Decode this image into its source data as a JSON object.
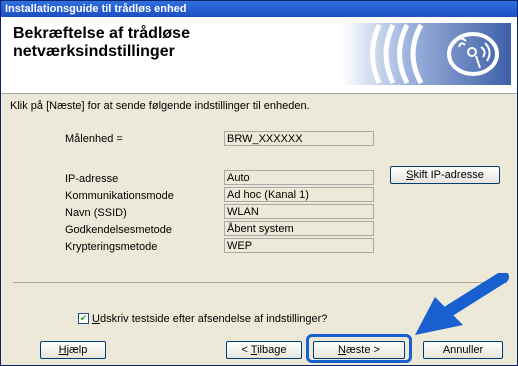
{
  "window": {
    "title": "Installationsguide til trådløs enhed"
  },
  "header": {
    "title_line1": "Bekræftelse af trådløse",
    "title_line2": "netværksindstillinger"
  },
  "instruction": "Klik på [Næste] for at sende følgende indstillinger til enheden.",
  "device": {
    "label": "Målenhed =",
    "value": "BRW_XXXXXX"
  },
  "settings": [
    {
      "label": "IP-adresse",
      "value": "Auto"
    },
    {
      "label": "Kommunikationsmode",
      "value": "Ad hoc (Kanal 1)"
    },
    {
      "label": "Navn (SSID)",
      "value": "WLAN"
    },
    {
      "label": "Godkendelsesmetode",
      "value": "Åbent system"
    },
    {
      "label": "Krypteringsmetode",
      "value": "WEP"
    }
  ],
  "buttons": {
    "change_ip": {
      "mnemonic": "S",
      "rest": "kift IP-adresse"
    },
    "help": {
      "mnemonic": "H",
      "rest": "jælp"
    },
    "back": {
      "prefix": "< ",
      "mnemonic": "T",
      "rest": "ilbage"
    },
    "next": {
      "mnemonic": "N",
      "rest": "æste >"
    },
    "cancel": "Annuller"
  },
  "checkbox": {
    "checked": true,
    "mnemonic": "U",
    "rest": "dskriv testside efter afsendelse af indstillinger?"
  },
  "colors": {
    "title_bar": "#1d4fc2",
    "accent_blue": "#1a5fd0"
  },
  "icons": {
    "wireless": "wireless-signal-icon",
    "arrow": "pointer-arrow-icon"
  }
}
